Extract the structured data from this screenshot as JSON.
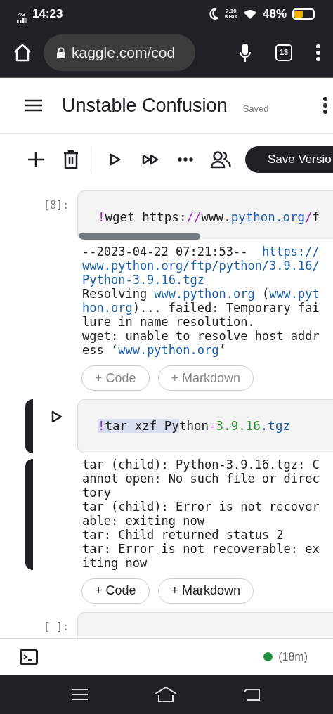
{
  "status_bar": {
    "network": "4G",
    "time": "14:23",
    "speed": "7.10",
    "speed_unit": "KB/s",
    "battery": "48%"
  },
  "browser": {
    "url": "kaggle.com/cod",
    "tabs_count": "13"
  },
  "header": {
    "title": "Unstable Confusion",
    "save_state": "Saved"
  },
  "toolbar": {
    "save_button": "Save Versio"
  },
  "cells": [
    {
      "prompt": "[8]:",
      "active": false,
      "code": [
        {
          "kind": "magic",
          "text": "!",
          "selected": false
        },
        {
          "kind": "plain",
          "text": "wget https:",
          "selected": false
        },
        {
          "kind": "magic",
          "text": "//",
          "selected": false
        },
        {
          "kind": "plain",
          "text": "www.",
          "selected": false
        },
        {
          "kind": "attr",
          "text": "python.org",
          "selected": false
        },
        {
          "kind": "magic",
          "text": "/",
          "selected": false
        },
        {
          "kind": "plain",
          "text": "f",
          "selected": false
        }
      ],
      "output": [
        [
          {
            "kind": "plain",
            "text": "--2023-04-22 07:21:53--  "
          },
          {
            "kind": "link",
            "text": "https://www.python.org/ftp/python/3.9.16/Python-3.9.16.tgz"
          }
        ],
        [
          {
            "kind": "plain",
            "text": "Resolving "
          },
          {
            "kind": "link",
            "text": "www.python.org"
          },
          {
            "kind": "plain",
            "text": " ("
          },
          {
            "kind": "link",
            "text": "www.python.org"
          },
          {
            "kind": "plain",
            "text": ")... failed: Temporary failure in name resolution."
          }
        ],
        [
          {
            "kind": "plain",
            "text": "wget: unable to resolve host address ‘"
          },
          {
            "kind": "link",
            "text": "www.python.org"
          },
          {
            "kind": "plain",
            "text": "’"
          }
        ]
      ],
      "add_buttons": [
        "+ Code",
        "+ Markdown"
      ]
    },
    {
      "active": true,
      "code": [
        {
          "kind": "magic",
          "text": "!",
          "selected": true
        },
        {
          "kind": "plain",
          "text": "tar xzf Py",
          "selected": true
        },
        {
          "kind": "plain",
          "text": "thon",
          "selected": false
        },
        {
          "kind": "magic",
          "text": "-",
          "selected": false
        },
        {
          "kind": "number",
          "text": "3.9.16",
          "selected": false
        },
        {
          "kind": "attr",
          "text": ".tgz",
          "selected": false
        }
      ],
      "output": [
        [
          {
            "kind": "plain",
            "text": "tar (child): Python-3.9.16.tgz: Cannot open: No such file or directory"
          }
        ],
        [
          {
            "kind": "plain",
            "text": "tar (child): Error is not recoverable: exiting now"
          }
        ],
        [
          {
            "kind": "plain",
            "text": "tar: Child returned status 2"
          }
        ],
        [
          {
            "kind": "plain",
            "text": "tar: Error is not recoverable: exiting now"
          }
        ]
      ],
      "add_buttons": [
        "+ Code",
        "+ Markdown"
      ]
    },
    {
      "prompt": "[ ]:",
      "active": false
    }
  ],
  "footer": {
    "session_time": "(18m)"
  }
}
